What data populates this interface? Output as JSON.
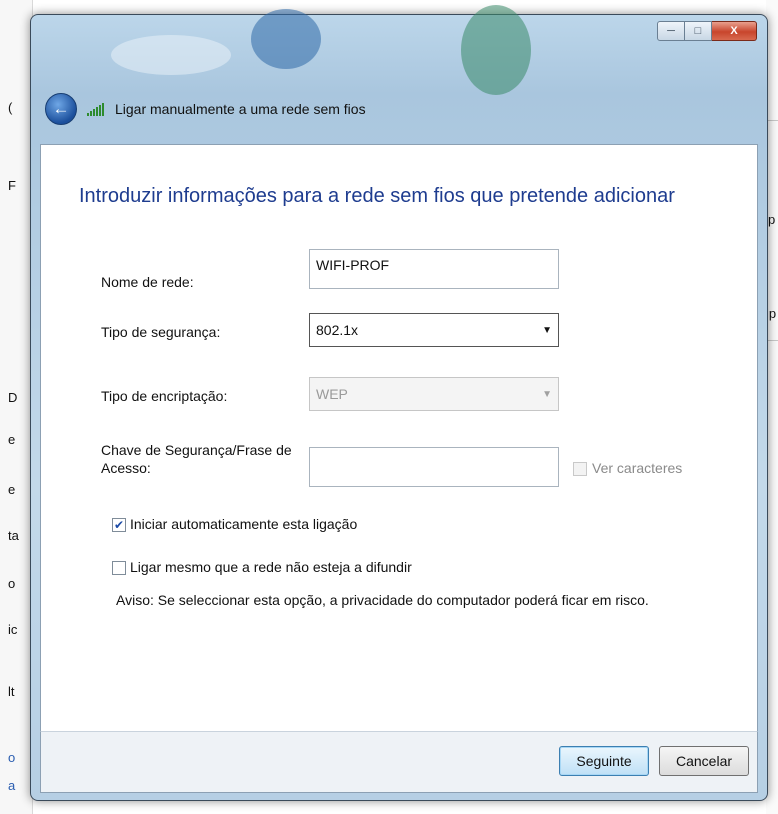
{
  "background": {
    "left_chars": [
      "(",
      "F",
      "D",
      "e",
      "e",
      "ta",
      "o",
      "ic",
      "lt",
      "o",
      "a"
    ],
    "right_chars": [
      "p",
      "ip"
    ]
  },
  "window": {
    "title": "Ligar manualmente a uma rede sem fios",
    "controls": {
      "minimize": "─",
      "maximize": "□",
      "close": "X"
    }
  },
  "main": {
    "heading": "Introduzir informações para a rede sem fios que pretende adicionar",
    "network_name": {
      "label": "Nome de rede:",
      "value": "WIFI-PROF"
    },
    "security_type": {
      "label": "Tipo de segurança:",
      "selected": "802.1x"
    },
    "encryption_type": {
      "label": "Tipo de encriptação:",
      "selected": "WEP"
    },
    "security_key": {
      "label_line1": "Chave de Segurança/Frase de",
      "label_line2": "Acesso:",
      "value": "",
      "show_chars_label": "Ver caracteres"
    },
    "auto_connect": {
      "label": "Iniciar automaticamente esta ligação",
      "checked": true
    },
    "connect_hidden": {
      "label": "Ligar mesmo que a rede não esteja a difundir",
      "checked": false
    },
    "warning": "Aviso: Se seleccionar esta opção, a privacidade do computador poderá ficar em risco."
  },
  "footer": {
    "next_label": "Seguinte",
    "cancel_label": "Cancelar"
  },
  "colors": {
    "heading": "#1e3c8f",
    "frame": "#b6cfe4",
    "accent": "#3c7fb1"
  },
  "icons": {
    "back": "back-arrow-icon",
    "signal": "wireless-signal-icon",
    "check": "checkmark-icon",
    "dropdown": "chevron-down-icon"
  }
}
